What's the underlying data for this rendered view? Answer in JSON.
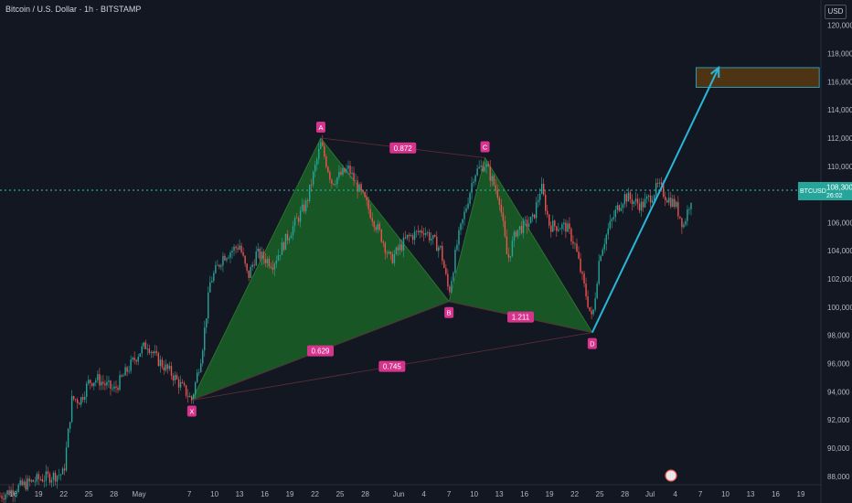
{
  "header": {
    "title": "Bitcoin / U.S. Dollar · 1h · BITSTAMP"
  },
  "currency_button": {
    "label": "USD"
  },
  "price_tag": {
    "symbol": "BTCUSD",
    "price": "108,300",
    "countdown": "26:02"
  },
  "colors": {
    "background": "#131722",
    "up": "#26a69a",
    "down": "#ef5350",
    "pattern_fill": "#1f8a2a",
    "pattern_label": "#d6348c",
    "projection": "#29b6d9",
    "target_box": "#5b3a12",
    "axis_text": "#b2b5be",
    "price_line": "#26a69a"
  },
  "chart_data": {
    "type": "candlestick",
    "title": "Bitcoin / U.S. Dollar · 1h · BITSTAMP",
    "yaxis": {
      "ticks": [
        120000,
        118000,
        116000,
        114000,
        112000,
        110000,
        108000,
        106000,
        104000,
        102000,
        100000,
        98000,
        96000,
        94000,
        92000,
        90000,
        88000
      ],
      "tick_labels": [
        "120,000",
        "118,000",
        "116,000",
        "114,000",
        "112,000",
        "110,000",
        "108,000",
        "106,000",
        "104,000",
        "102,000",
        "100,000",
        "98,000",
        "96,000",
        "94,000",
        "92,000",
        "90,000",
        "88,000"
      ],
      "ylim": [
        87400,
        121800
      ]
    },
    "xaxis": {
      "tick_labels": [
        "16",
        "19",
        "22",
        "25",
        "28",
        "May",
        "7",
        "10",
        "13",
        "16",
        "19",
        "22",
        "25",
        "28",
        "Jun",
        "4",
        "7",
        "10",
        "13",
        "16",
        "19",
        "22",
        "25",
        "28",
        "Jul",
        "4",
        "7",
        "10",
        "13",
        "16",
        "19"
      ],
      "tick_days": [
        15,
        18,
        21,
        24,
        27,
        30,
        36,
        39,
        42,
        45,
        48,
        51,
        54,
        57,
        61,
        64,
        67,
        70,
        73,
        76,
        79,
        82,
        85,
        88,
        91,
        94,
        97,
        100,
        103,
        106,
        109
      ],
      "day_min": 13.4,
      "day_max": 111.4
    },
    "pattern": {
      "name": "XABCD",
      "points": [
        {
          "label": "X",
          "day": 36.3,
          "price": 93400
        },
        {
          "label": "A",
          "day": 51.7,
          "price": 112000
        },
        {
          "label": "B",
          "day": 67.0,
          "price": 100400
        },
        {
          "label": "C",
          "day": 71.3,
          "price": 110600
        },
        {
          "label": "D",
          "day": 84.1,
          "price": 98200
        }
      ],
      "ratios": [
        {
          "label": "0.872",
          "from": "A",
          "to": "C"
        },
        {
          "label": "0.629",
          "from": "X",
          "to": "B"
        },
        {
          "label": "1.211",
          "from": "B",
          "to": "D"
        },
        {
          "label": "0.745",
          "from": "X",
          "to": "D"
        }
      ]
    },
    "projection": {
      "from": {
        "day": 84.1,
        "price": 98200
      },
      "to": {
        "day": 99.2,
        "price": 117000
      }
    },
    "target_zone": {
      "day_start": 96.5,
      "day_end": 111.2,
      "price_low": 115600,
      "price_high": 117000
    },
    "last_price": 108300,
    "ohlc_key_points": [
      [
        13.4,
        86600
      ],
      [
        15.5,
        87200
      ],
      [
        18,
        87800
      ],
      [
        21,
        88200
      ],
      [
        22,
        93500
      ],
      [
        23,
        93400
      ],
      [
        24,
        94700
      ],
      [
        25,
        94900
      ],
      [
        27,
        94100
      ],
      [
        28,
        95000
      ],
      [
        30,
        96800
      ],
      [
        31,
        97400
      ],
      [
        32,
        96400
      ],
      [
        34,
        95200
      ],
      [
        36.3,
        93400
      ],
      [
        37.5,
        96800
      ],
      [
        38.5,
        101800
      ],
      [
        40,
        103600
      ],
      [
        42,
        104400
      ],
      [
        43,
        102100
      ],
      [
        44,
        103800
      ],
      [
        46,
        103100
      ],
      [
        48,
        105300
      ],
      [
        50,
        107400
      ],
      [
        51.7,
        111600
      ],
      [
        53,
        108900
      ],
      [
        55,
        109800
      ],
      [
        57,
        107500
      ],
      [
        59,
        104900
      ],
      [
        60,
        103300
      ],
      [
        62,
        104900
      ],
      [
        64,
        105500
      ],
      [
        66,
        104100
      ],
      [
        67,
        101000
      ],
      [
        68,
        104600
      ],
      [
        69,
        107000
      ],
      [
        70,
        109500
      ],
      [
        71.3,
        110200
      ],
      [
        73,
        107800
      ],
      [
        74,
        103300
      ],
      [
        75,
        105400
      ],
      [
        77,
        106200
      ],
      [
        78,
        108600
      ],
      [
        79,
        105800
      ],
      [
        81,
        105700
      ],
      [
        82,
        104500
      ],
      [
        83,
        101800
      ],
      [
        84.1,
        99000
      ],
      [
        85,
        103800
      ],
      [
        86,
        105500
      ],
      [
        87,
        106900
      ],
      [
        88,
        107900
      ],
      [
        90,
        107200
      ],
      [
        91,
        107800
      ],
      [
        92,
        108600
      ],
      [
        93,
        107800
      ],
      [
        94,
        107300
      ],
      [
        95,
        105800
      ],
      [
        96,
        108000
      ]
    ]
  }
}
